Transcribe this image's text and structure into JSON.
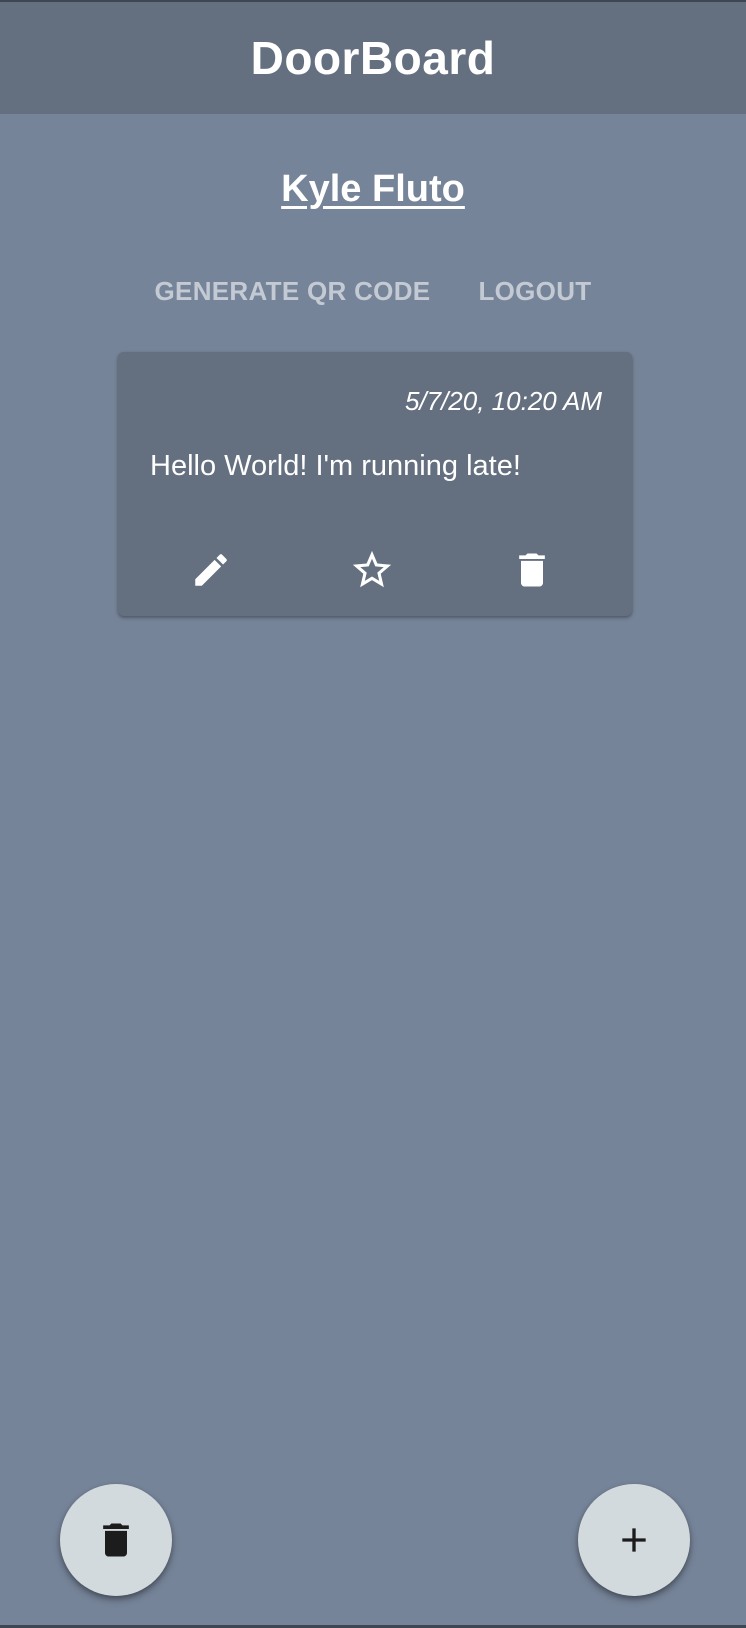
{
  "app": {
    "title": "DoorBoard"
  },
  "user": {
    "name": "Kyle Fluto"
  },
  "actions": {
    "generate_qr": "GENERATE QR CODE",
    "logout": "LOGOUT"
  },
  "notes": [
    {
      "timestamp": "5/7/20, 10:20 AM",
      "message": "Hello World! I'm running late!",
      "icons": [
        "pencil-icon",
        "star-outline-icon",
        "trash-icon"
      ]
    }
  ],
  "fabs": {
    "delete_icon": "trash-icon",
    "add_icon": "plus-icon"
  },
  "colors": {
    "background": "#768499",
    "app_bar": "#646f7f",
    "card": "#646f7f",
    "fab": "#d3dadd",
    "text_button": "#c4cad3"
  }
}
